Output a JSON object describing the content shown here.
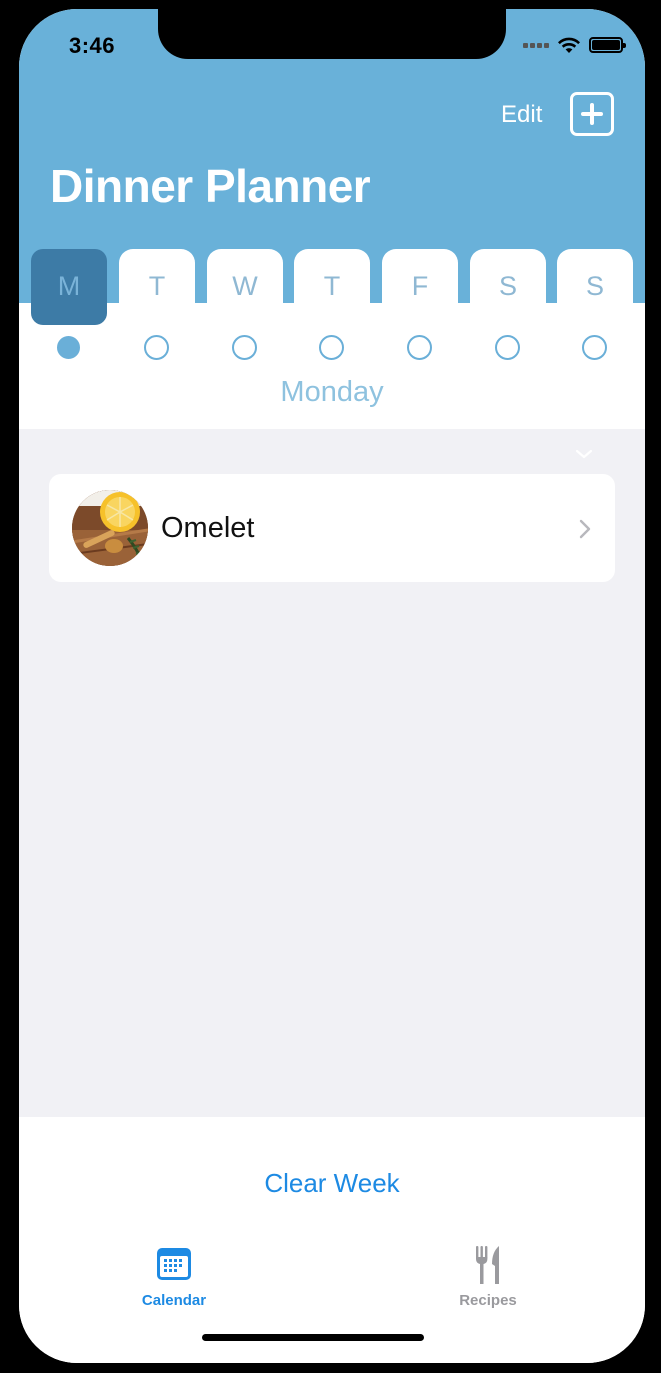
{
  "status_bar": {
    "time": "3:46"
  },
  "nav": {
    "edit_label": "Edit",
    "add_icon": "plus-square-icon",
    "title": "Dinner Planner"
  },
  "days": {
    "letters": [
      "M",
      "T",
      "W",
      "T",
      "F",
      "S",
      "S"
    ],
    "selected_index": 0,
    "filled_dots": [
      true,
      false,
      false,
      false,
      false,
      false,
      false
    ],
    "selected_day_name": "Monday"
  },
  "meals": [
    {
      "name": "Omelet",
      "thumbnail": "food-photo"
    }
  ],
  "footer": {
    "clear_week_label": "Clear Week"
  },
  "tab_bar": {
    "items": [
      {
        "label": "Calendar",
        "icon": "calendar-icon",
        "active": true
      },
      {
        "label": "Recipes",
        "icon": "fork-knife-icon",
        "active": false
      }
    ]
  },
  "colors": {
    "header_bg": "#69b1d9",
    "selected_tab": "#3d7ba6",
    "accent_blue": "#1d8ae3",
    "content_bg": "#f1f1f5"
  }
}
